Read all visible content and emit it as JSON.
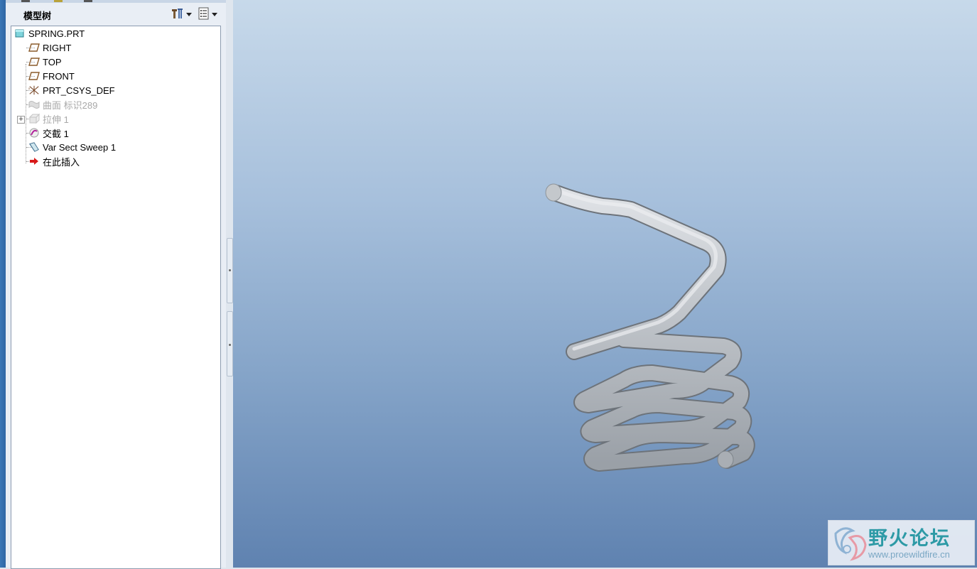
{
  "panel": {
    "title": "模型树",
    "settings_button": "tree-settings-icon",
    "show_button": "tree-show-icon"
  },
  "tree": {
    "items": [
      {
        "label": "SPRING.PRT",
        "icon": "part-icon",
        "dimmed": false
      },
      {
        "label": "RIGHT",
        "icon": "datum-plane-icon",
        "dimmed": false
      },
      {
        "label": "TOP",
        "icon": "datum-plane-icon",
        "dimmed": false
      },
      {
        "label": "FRONT",
        "icon": "datum-plane-icon",
        "dimmed": false
      },
      {
        "label": "PRT_CSYS_DEF",
        "icon": "coordinate-system-icon",
        "dimmed": false
      },
      {
        "label": "曲面 标识289",
        "icon": "surface-icon",
        "dimmed": true
      },
      {
        "label": "拉伸 1",
        "icon": "extrude-icon",
        "dimmed": true
      },
      {
        "label": "交截 1",
        "icon": "intersect-icon",
        "dimmed": false
      },
      {
        "label": "Var Sect Sweep 1",
        "icon": "sweep-icon",
        "dimmed": false
      },
      {
        "label": "在此插入",
        "icon": "insert-here-arrow-icon",
        "dimmed": false
      }
    ]
  },
  "viewport": {
    "model": "spring-sweep-model",
    "background_top": "#c7d9ea",
    "background_bottom": "#5f82b0",
    "model_color": "#b9bec4"
  },
  "watermark": {
    "title": "野火论坛",
    "url": "www.proewildfire.cn"
  }
}
